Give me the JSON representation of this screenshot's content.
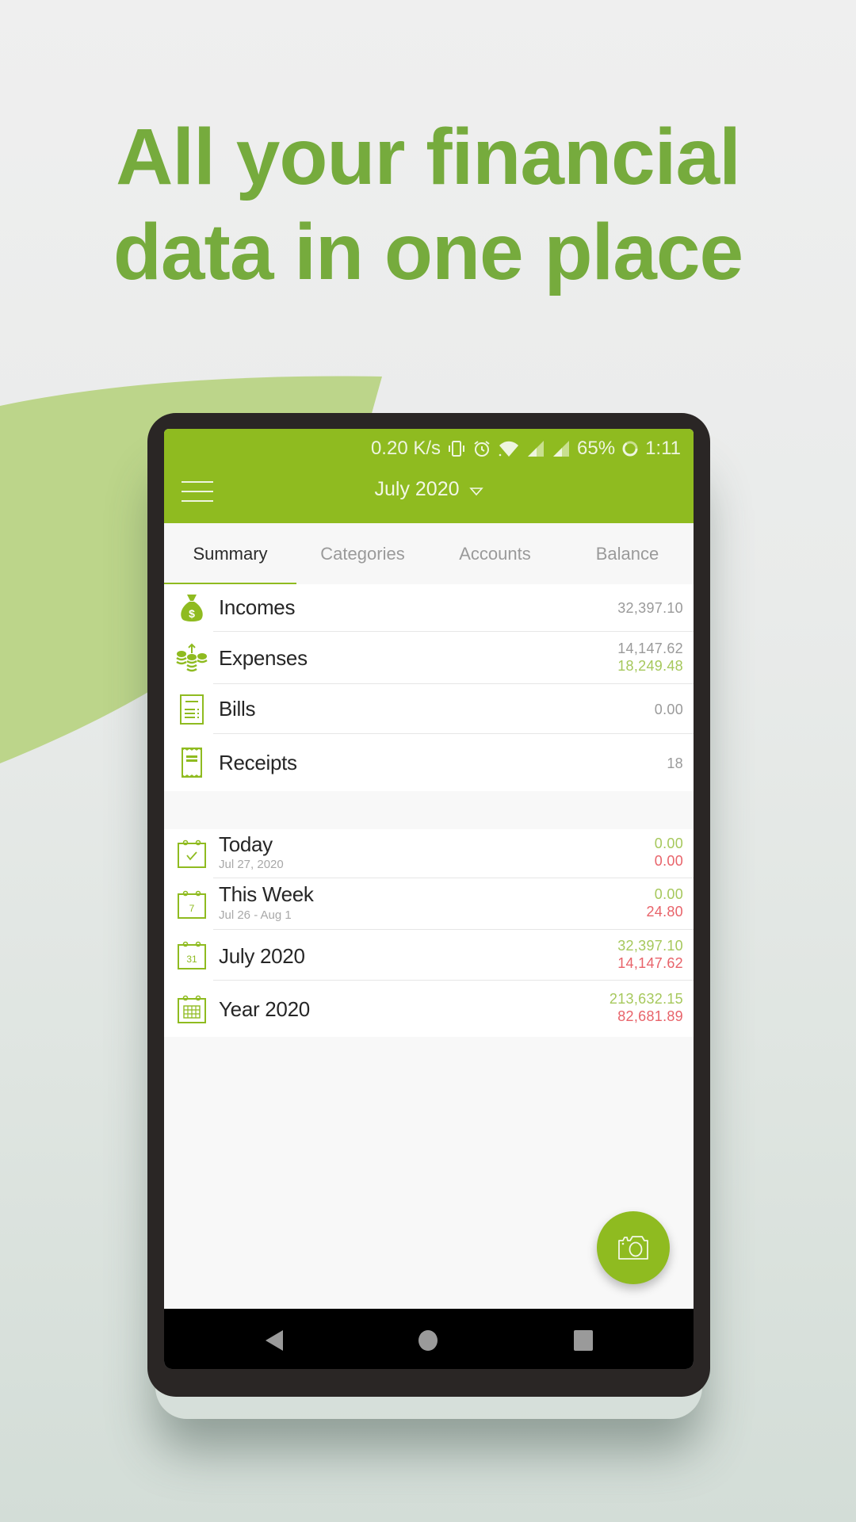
{
  "headline": {
    "line1": "All your financial",
    "line2": "data in one place"
  },
  "colors": {
    "brand_green": "#8fbb20",
    "headline_green": "#76ab3d",
    "income_green": "#a6c85c",
    "expense_red": "#e8636a"
  },
  "status_bar": {
    "speed": "0.20 K/s",
    "icons": [
      "vibrate-icon",
      "alarm-icon",
      "wifi-icon",
      "signal-icon",
      "signal-icon"
    ],
    "battery": "65%",
    "time": "1:11"
  },
  "app_bar": {
    "menu_icon": "hamburger-menu-icon",
    "period": "July 2020",
    "dropdown_icon": "triangle-down-icon"
  },
  "tabs": [
    {
      "label": "Summary",
      "active": true
    },
    {
      "label": "Categories",
      "active": false
    },
    {
      "label": "Accounts",
      "active": false
    },
    {
      "label": "Balance",
      "active": false
    }
  ],
  "summary": [
    {
      "icon": "money-bag-icon",
      "label": "Incomes",
      "values": [
        "32,397.10"
      ]
    },
    {
      "icon": "coins-icon",
      "label": "Expenses",
      "values": [
        "14,147.62",
        "18,249.48"
      ]
    },
    {
      "icon": "bill-icon",
      "label": "Bills",
      "values": [
        "0.00"
      ]
    },
    {
      "icon": "receipt-icon",
      "label": "Receipts",
      "values": [
        "18"
      ]
    }
  ],
  "periods": [
    {
      "icon": "calendar-check-icon",
      "label": "Today",
      "sub": "Jul 27, 2020",
      "income": "0.00",
      "expense": "0.00"
    },
    {
      "icon": "calendar-week-icon",
      "icon_text": "7",
      "label": "This Week",
      "sub": "Jul 26 - Aug 1",
      "income": "0.00",
      "expense": "24.80"
    },
    {
      "icon": "calendar-month-icon",
      "icon_text": "31",
      "label": "July 2020",
      "income": "32,397.10",
      "expense": "14,147.62"
    },
    {
      "icon": "calendar-year-icon",
      "label": "Year 2020",
      "income": "213,632.15",
      "expense": "82,681.89"
    }
  ],
  "fab": {
    "icon": "camera-icon"
  },
  "nav": {
    "back": "back-icon",
    "home": "home-icon",
    "recents": "recents-icon"
  }
}
